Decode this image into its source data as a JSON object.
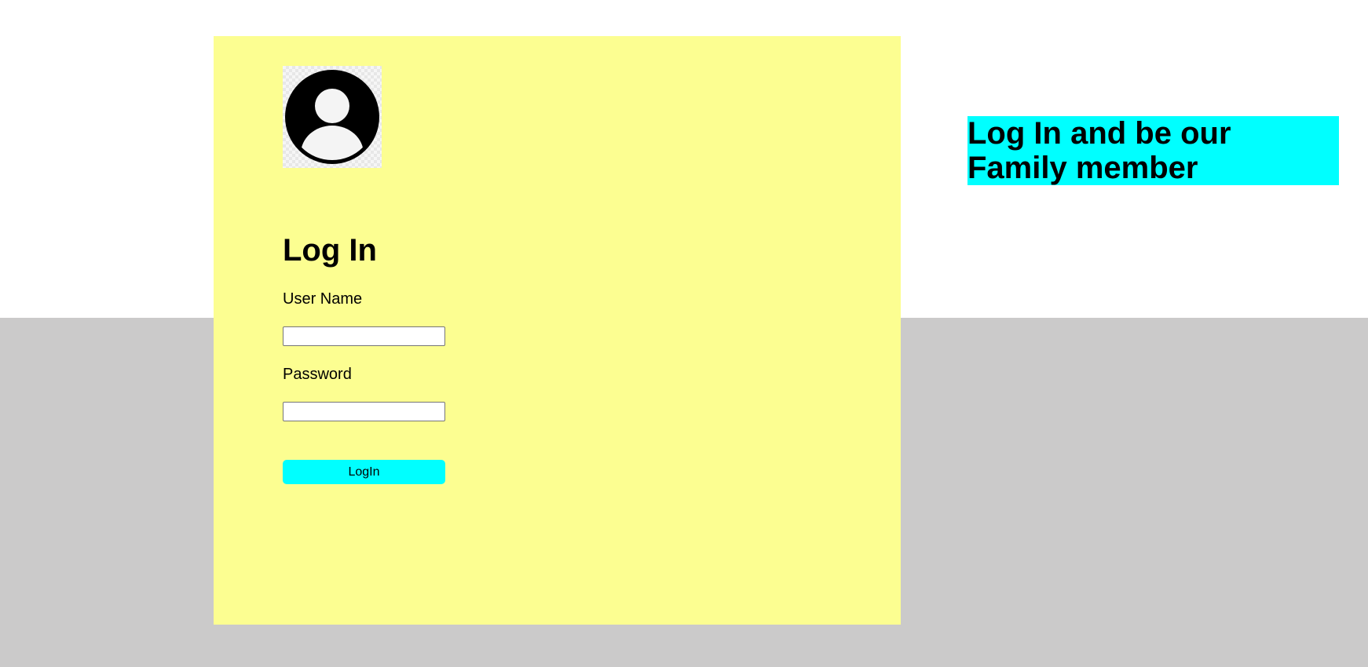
{
  "colors": {
    "panel_background": "#fcfe91",
    "lower_background": "#cbcaca",
    "accent": "#00ffff",
    "page_background": "#ffffff"
  },
  "login_form": {
    "avatar_icon": "user-avatar-icon",
    "title": "Log In",
    "username_label": "User Name",
    "username_value": "",
    "password_label": "Password",
    "password_value": "",
    "submit_label": "LogIn"
  },
  "promo": {
    "heading": "Log In and be our Family member"
  }
}
